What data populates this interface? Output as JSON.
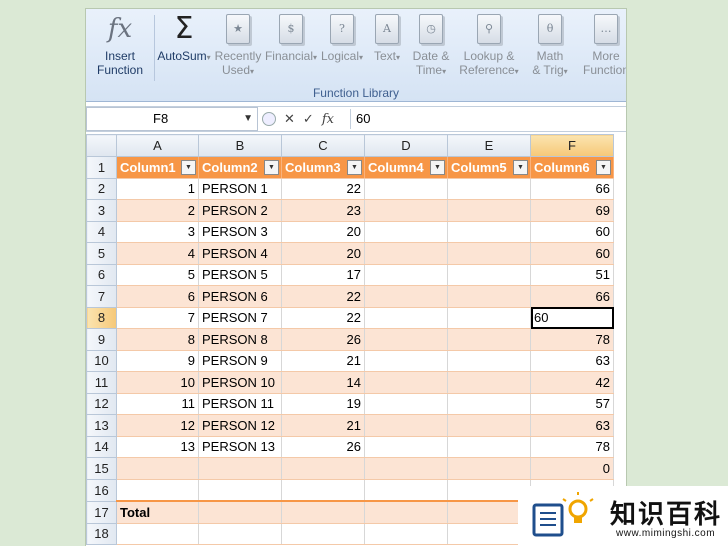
{
  "ribbon": {
    "buttons": [
      {
        "label1": "Insert",
        "label2": "Function",
        "icon": "fx-icon",
        "glyph": "fx",
        "arrow": false
      },
      {
        "label1": "AutoSum",
        "label2": "",
        "icon": "sigma-icon",
        "glyph": "Σ",
        "arrow": true
      },
      {
        "label1": "Recently",
        "label2": "Used",
        "icon": "star-book-icon",
        "glyph": "★",
        "arrow": true
      },
      {
        "label1": "Financial",
        "label2": "",
        "icon": "financial-book-icon",
        "glyph": "$",
        "arrow": true
      },
      {
        "label1": "Logical",
        "label2": "",
        "icon": "logical-book-icon",
        "glyph": "?",
        "arrow": true
      },
      {
        "label1": "Text",
        "label2": "",
        "icon": "text-book-icon",
        "glyph": "A",
        "arrow": true
      },
      {
        "label1": "Date &",
        "label2": "Time",
        "icon": "date-book-icon",
        "glyph": "◷",
        "arrow": true
      },
      {
        "label1": "Lookup &",
        "label2": "Reference",
        "icon": "lookup-book-icon",
        "glyph": "⚲",
        "arrow": true
      },
      {
        "label1": "Math",
        "label2": "& Trig",
        "icon": "math-book-icon",
        "glyph": "θ",
        "arrow": true
      },
      {
        "label1": "More",
        "label2": "Function",
        "icon": "more-book-icon",
        "glyph": "…",
        "arrow": false
      }
    ],
    "group_label": "Function Library"
  },
  "formula_bar": {
    "name_box": "F8",
    "fx_symbol": "fx",
    "cancel": "✕",
    "enter": "✓",
    "value": "60"
  },
  "grid": {
    "columns": [
      "A",
      "B",
      "C",
      "D",
      "E",
      "F"
    ],
    "selected_column": "F",
    "header_row": [
      "Column1",
      "Column2",
      "Column3",
      "Column4",
      "Column5",
      "Column6"
    ],
    "rows": [
      {
        "n": "2",
        "a": "1",
        "b": "PERSON 1",
        "c": "22",
        "d": "",
        "e": "",
        "f": "66"
      },
      {
        "n": "3",
        "a": "2",
        "b": "PERSON 2",
        "c": "23",
        "d": "",
        "e": "",
        "f": "69"
      },
      {
        "n": "4",
        "a": "3",
        "b": "PERSON 3",
        "c": "20",
        "d": "",
        "e": "",
        "f": "60"
      },
      {
        "n": "5",
        "a": "4",
        "b": "PERSON 4",
        "c": "20",
        "d": "",
        "e": "",
        "f": "60"
      },
      {
        "n": "6",
        "a": "5",
        "b": "PERSON 5",
        "c": "17",
        "d": "",
        "e": "",
        "f": "51"
      },
      {
        "n": "7",
        "a": "6",
        "b": "PERSON 6",
        "c": "22",
        "d": "",
        "e": "",
        "f": "66"
      },
      {
        "n": "8",
        "a": "7",
        "b": "PERSON 7",
        "c": "22",
        "d": "",
        "e": "",
        "f": "60"
      },
      {
        "n": "9",
        "a": "8",
        "b": "PERSON 8",
        "c": "26",
        "d": "",
        "e": "",
        "f": "78"
      },
      {
        "n": "10",
        "a": "9",
        "b": "PERSON 9",
        "c": "21",
        "d": "",
        "e": "",
        "f": "63"
      },
      {
        "n": "11",
        "a": "10",
        "b": "PERSON 10",
        "c": "14",
        "d": "",
        "e": "",
        "f": "42"
      },
      {
        "n": "12",
        "a": "11",
        "b": "PERSON 11",
        "c": "19",
        "d": "",
        "e": "",
        "f": "57"
      },
      {
        "n": "13",
        "a": "12",
        "b": "PERSON 12",
        "c": "21",
        "d": "",
        "e": "",
        "f": "63"
      },
      {
        "n": "14",
        "a": "13",
        "b": "PERSON 13",
        "c": "26",
        "d": "",
        "e": "",
        "f": "78"
      },
      {
        "n": "15",
        "a": "",
        "b": "",
        "c": "",
        "d": "",
        "e": "",
        "f": "0"
      },
      {
        "n": "16",
        "a": "",
        "b": "",
        "c": "",
        "d": "",
        "e": "",
        "f": ""
      },
      {
        "n": "17",
        "a": "Total",
        "b": "",
        "c": "",
        "d": "",
        "e": "",
        "f": ""
      },
      {
        "n": "18",
        "a": "",
        "b": "",
        "c": "",
        "d": "",
        "e": "",
        "f": ""
      }
    ],
    "header_row_number": "1",
    "active_row": "8"
  },
  "watermark": {
    "title": "知识百科",
    "url": "www.mimingshi.com"
  },
  "colors": {
    "table_header": "#f79646",
    "band": "#fce4d4",
    "selected_header": "#f6c878"
  }
}
